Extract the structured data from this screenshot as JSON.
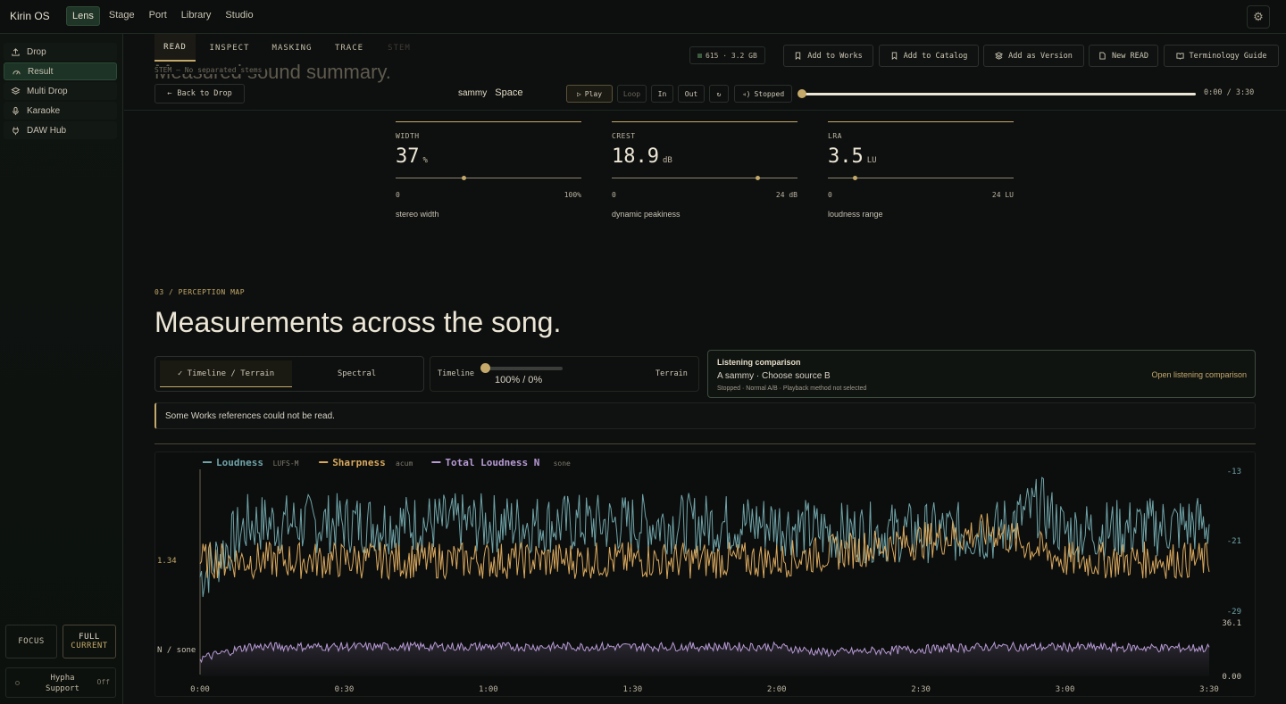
{
  "app": {
    "title": "Kirin OS"
  },
  "topnav": [
    {
      "label": "Lens",
      "active": true
    },
    {
      "label": "Stage",
      "active": false
    },
    {
      "label": "Port",
      "active": false
    },
    {
      "label": "Library",
      "active": false
    },
    {
      "label": "Studio",
      "active": false
    }
  ],
  "sidebar": {
    "items": [
      {
        "label": "Drop",
        "icon": "upload-icon",
        "active": false
      },
      {
        "label": "Result",
        "icon": "gauge-icon",
        "active": true
      },
      {
        "label": "Multi Drop",
        "icon": "layers-icon",
        "active": false
      },
      {
        "label": "Karaoke",
        "icon": "microphone-icon",
        "active": false
      },
      {
        "label": "DAW Hub",
        "icon": "plug-icon",
        "active": false
      }
    ],
    "focus_label": "FOCUS",
    "full_label": "FULL",
    "full_sub": "CURRENT",
    "hypha_label": "Hypha Support",
    "hypha_state": "Off"
  },
  "tabs": [
    {
      "label": "READ",
      "state": "active"
    },
    {
      "label": "INSPECT",
      "state": "normal"
    },
    {
      "label": "MASKING",
      "state": "normal"
    },
    {
      "label": "TRACE",
      "state": "normal"
    },
    {
      "label": "STEM",
      "state": "disabled"
    }
  ],
  "ghost": {
    "heading": "Measured sound summary.",
    "stem_line": "STEM — No separated stems"
  },
  "toolbar": {
    "usage": "615 · 3.2 GB",
    "add_to_works": "Add to Works",
    "add_to_catalog": "Add to Catalog",
    "add_as_version": "Add as Version",
    "new_read": "New READ",
    "terminology_guide": "Terminology Guide"
  },
  "transport": {
    "back": "Back to Drop",
    "artist": "sammy",
    "track": "Space",
    "play": "Play",
    "loop": "Loop",
    "in": "In",
    "out": "Out",
    "status": "Stopped",
    "time": "0:00 / 3:30",
    "progress": 0
  },
  "metrics": [
    {
      "label": "WIDTH",
      "value": "37",
      "unit": "%",
      "min": "0",
      "max": "100%",
      "desc": "stereo width",
      "position": 0.37
    },
    {
      "label": "CREST",
      "value": "18.9",
      "unit": "dB",
      "min": "0",
      "max": "24 dB",
      "desc": "dynamic peakiness",
      "position": 0.787
    },
    {
      "label": "LRA",
      "value": "3.5",
      "unit": "LU",
      "min": "0",
      "max": "24 LU",
      "desc": "loudness range",
      "position": 0.146
    }
  ],
  "section": {
    "eyebrow": "03 / PERCEPTION MAP",
    "title": "Measurements across the song."
  },
  "mode": {
    "option_a": "✓ Timeline / Terrain",
    "option_b": "Spectral",
    "blend_left": "Timeline",
    "blend_right": "Terrain",
    "blend_value": "100% / 0%",
    "blend_position": 0
  },
  "listening": {
    "title": "Listening comparison",
    "line": "A sammy · Choose source B",
    "status": "Stopped · Normal A/B · Playback method not selected",
    "link": "Open listening comparison"
  },
  "warning": "Some Works references could not be read.",
  "colors": {
    "accent": "#c5a96a",
    "loudness": "#6fa3a8",
    "sharpness": "#d9a85e",
    "total_loudness": "#b79ad6",
    "background": "#0e100f"
  },
  "chart_data": {
    "type": "line",
    "x_ticks": [
      "0:00",
      "0:30",
      "1:00",
      "1:30",
      "2:00",
      "2:30",
      "3:00",
      "3:30"
    ],
    "xlim_seconds": [
      0,
      210
    ],
    "series": [
      {
        "name": "Loudness",
        "unit": "LUFS-M",
        "axis": "right-top",
        "ylim": [
          -29,
          -13
        ],
        "approx_levels": [
          {
            "t": 0,
            "v": -26
          },
          {
            "t": 10,
            "v": -20
          },
          {
            "t": 120,
            "v": -20
          },
          {
            "t": 130,
            "v": -21
          },
          {
            "t": 165,
            "v": -21
          },
          {
            "t": 175,
            "v": -18
          },
          {
            "t": 180,
            "v": -21
          },
          {
            "t": 210,
            "v": -20
          }
        ]
      },
      {
        "name": "Sharpness",
        "unit": "acum",
        "axis": "left-mid",
        "reference": "1.34",
        "approx_levels": [
          {
            "t": 0,
            "v": 1.34
          },
          {
            "t": 120,
            "v": 1.34
          },
          {
            "t": 165,
            "v": 1.45
          },
          {
            "t": 180,
            "v": 1.34
          },
          {
            "t": 210,
            "v": 1.34
          }
        ]
      },
      {
        "name": "Total Loudness N",
        "unit": "sone",
        "axis": "right-bottom",
        "ylim": [
          0.0,
          36.1
        ],
        "approx_levels": [
          {
            "t": 0,
            "v": 12
          },
          {
            "t": 10,
            "v": 20
          },
          {
            "t": 120,
            "v": 20
          },
          {
            "t": 130,
            "v": 16
          },
          {
            "t": 165,
            "v": 20
          },
          {
            "t": 210,
            "v": 19
          }
        ]
      }
    ],
    "y_labels": {
      "right_top": [
        "-13",
        "-21",
        "-29"
      ],
      "right_bottom": [
        "36.1",
        "0.00"
      ],
      "left": [
        "1.34",
        "N / sone"
      ]
    },
    "legend_placement": "top-left",
    "grid": false
  }
}
